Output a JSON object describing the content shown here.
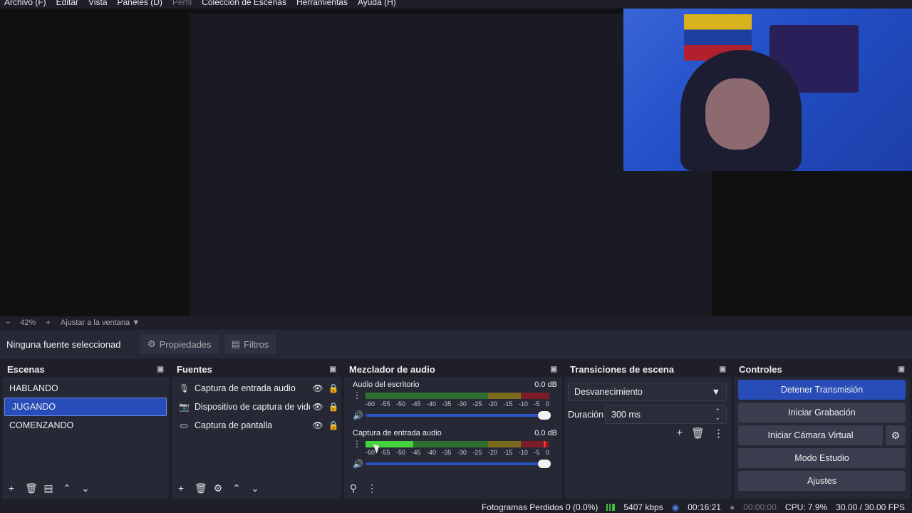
{
  "menu": {
    "items": [
      "Archivo (F)",
      "Editar",
      "Vista",
      "Paneles (D)",
      "Perfil",
      "Colección de Escenas",
      "Herramientas",
      "Ayuda (H)"
    ]
  },
  "zoom": {
    "minus": "−",
    "value": "42%",
    "plus": "+",
    "fit_label": "Ajustar a la ventana"
  },
  "properties_bar": {
    "no_source": "Ninguna fuente seleccionad",
    "properties_label": "Propiedades",
    "filters_label": "Filtros"
  },
  "scenes": {
    "title": "Escenas",
    "items": [
      "HABLANDO",
      "JUGANDO",
      "COMENZANDO"
    ],
    "selected": "JUGANDO"
  },
  "sources": {
    "title": "Fuentes",
    "items": [
      {
        "icon": "microphone-icon",
        "name": "Captura de entrada audio"
      },
      {
        "icon": "camera-icon",
        "name": "Dispositivo de captura de vide"
      },
      {
        "icon": "monitor-icon",
        "name": "Captura de pantalla"
      }
    ]
  },
  "mixer": {
    "title": "Mezclador de audio",
    "channels": [
      {
        "name": "Audio del escritorio",
        "db": "0.0 dB",
        "level": 0
      },
      {
        "name": "Captura de entrada audio",
        "db": "0.0 dB",
        "level": 0.26
      }
    ],
    "scale": [
      "-60",
      "-55",
      "-50",
      "-45",
      "-40",
      "-35",
      "-30",
      "-25",
      "-20",
      "-15",
      "-10",
      "-5",
      "0"
    ]
  },
  "transitions": {
    "title": "Transiciones de escena",
    "selected": "Desvanecimiento",
    "duration_label": "Duración",
    "duration_value": "300 ms"
  },
  "controls": {
    "title": "Controles",
    "stop_stream": "Detener Transmisión",
    "start_recording": "Iniciar Grabación",
    "start_vcam": "Iniciar Cámara Virtual",
    "studio_mode": "Modo Estudio",
    "settings": "Ajustes"
  },
  "status": {
    "dropped_frames": "Fotogramas Perdidos 0 (0.0%)",
    "bitrate": "5407 kbps",
    "stream_time": "00:16:21",
    "rec_time": "00:00:00",
    "cpu": "CPU: 7.9%",
    "fps": "30.00 / 30.00 FPS"
  },
  "colors": {
    "accent": "#284cb8",
    "panel": "#272836",
    "background": "#1e1f29"
  }
}
